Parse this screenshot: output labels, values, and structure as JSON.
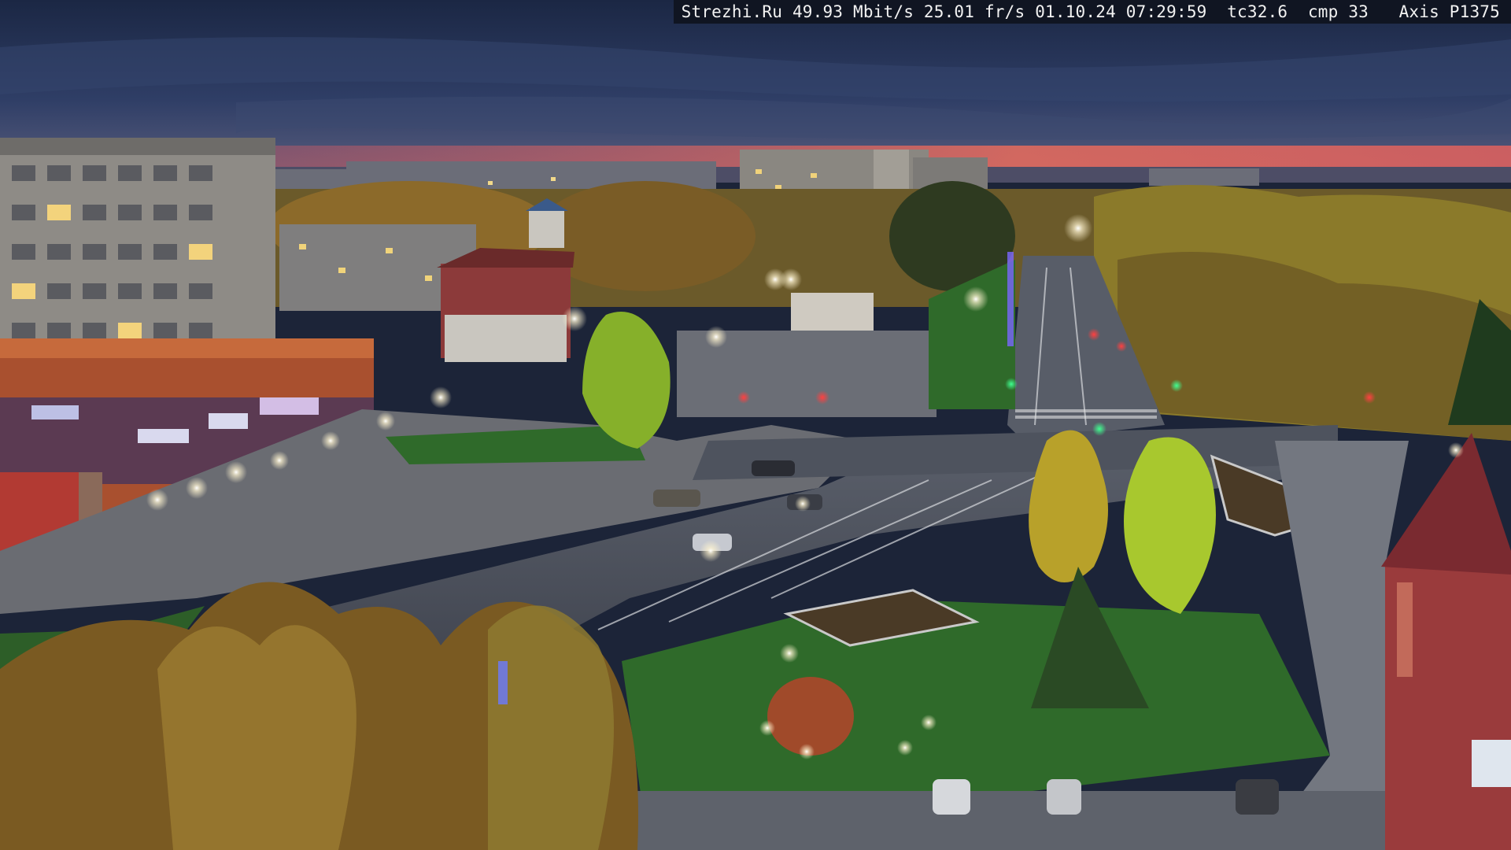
{
  "camera_overlay": {
    "site": "Strezhi.Ru",
    "bitrate": "49.93 Mbit/s",
    "framerate": "25.01 fr/s",
    "date": "01.10.24",
    "time": "07:29:59",
    "tc": "tc32.6",
    "cmp": "cmp 33",
    "camera_model": "Axis P1375"
  },
  "palette": {
    "sky_top": "#1e2a4a",
    "sky_mid": "#2e3d63",
    "sunset": "#d9605f",
    "road": "#4a4f5c",
    "grass": "#2f6a2a",
    "autumn_tree": "#a8862e",
    "green_tree": "#8fbf2e",
    "building": "#8d8a86",
    "brick_red": "#9a3b3c",
    "lamp": "#fff8e0"
  }
}
